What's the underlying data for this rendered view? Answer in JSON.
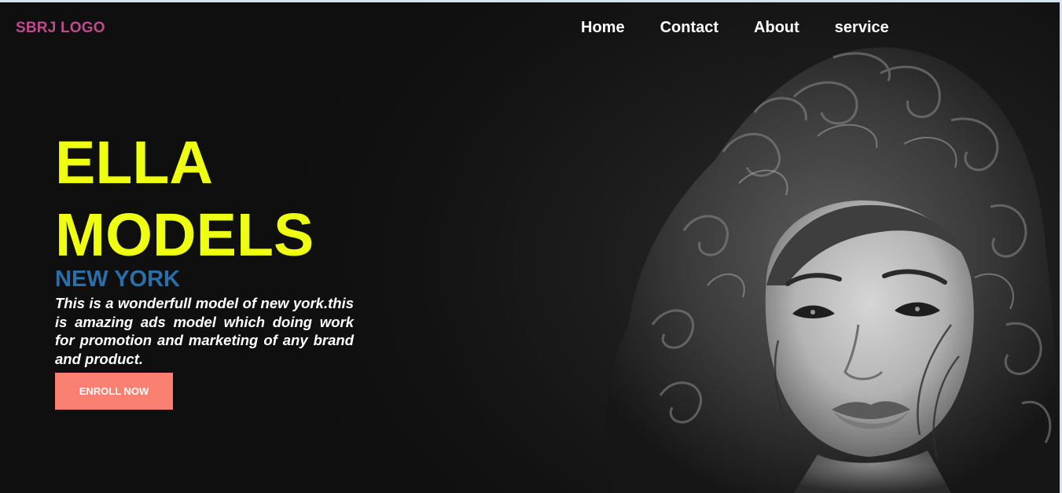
{
  "header": {
    "logo": "SBRJ LOGO",
    "nav": [
      "Home",
      "Contact",
      "About",
      "service"
    ]
  },
  "hero": {
    "title_line1": "ELLA",
    "title_line2": "MODELS",
    "city": "NEW YORK",
    "description": "This is a wonderfull model of new york.this is amazing ads model which doing work for promotion and marketing of any brand and product.",
    "cta": "ENROLL NOW"
  },
  "colors": {
    "background": "#121212",
    "logo": "#c04a8e",
    "title": "#eeff11",
    "city": "#2b6fa8",
    "cta_background": "#fa8072",
    "text": "#ffffff"
  }
}
